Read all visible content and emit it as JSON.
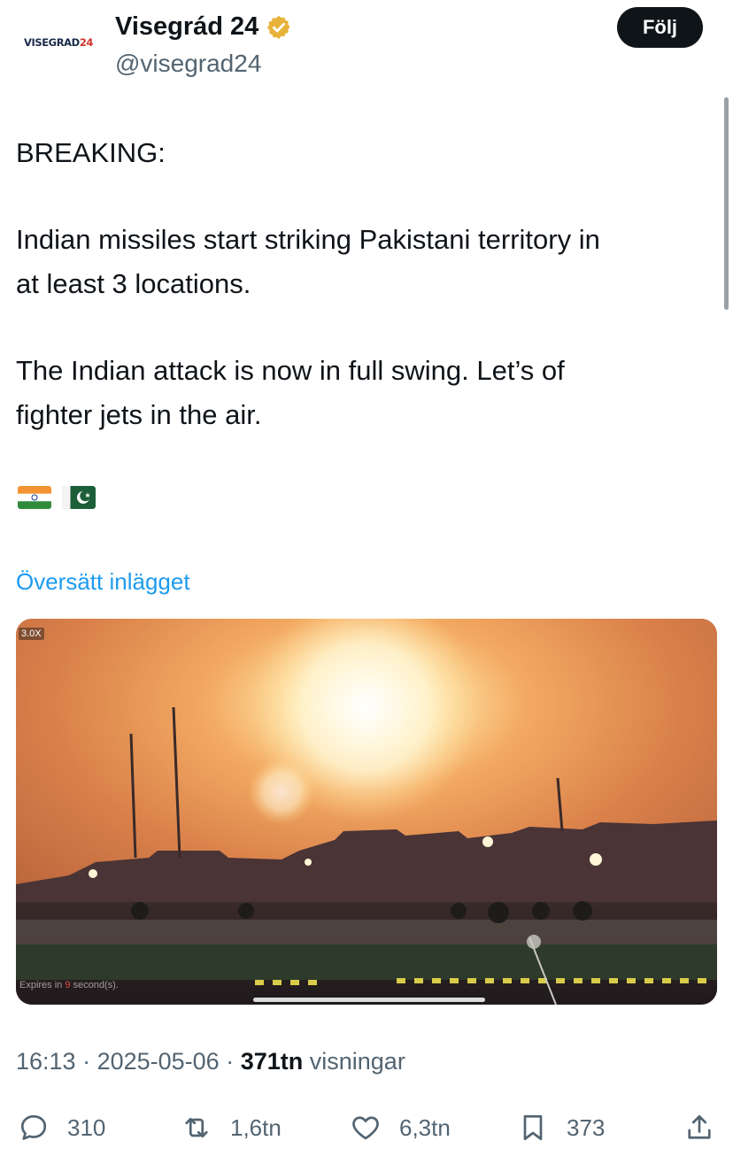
{
  "author": {
    "avatar_text_part1": "VISEGRAD",
    "avatar_text_part2": "24",
    "display_name": "Visegrád 24",
    "handle": "@visegrad24",
    "verified_badge": "gold-verified-icon"
  },
  "follow_button_label": "Följ",
  "tweet": {
    "line1": "BREAKING:",
    "line2": "Indian missiles start striking Pakistani territory in",
    "line3": "at least 3 locations.",
    "line4": "The Indian attack is now in full swing. Let’s of",
    "line5": "fighter jets in the air.",
    "flags": [
      "india-flag-icon",
      "pakistan-flag-icon"
    ]
  },
  "translate_link": "Översätt inlägget",
  "media": {
    "zoom_label": "3.0X",
    "expires_prefix": "Expires in ",
    "expires_number": "9",
    "expires_suffix": " second(s)."
  },
  "meta": {
    "time": "16:13",
    "separator": " · ",
    "date": "2025-05-06",
    "views_count": "371tn",
    "views_label": " visningar"
  },
  "actions": {
    "replies": "310",
    "reposts": "1,6tn",
    "likes": "6,3tn",
    "bookmarks": "373"
  },
  "colors": {
    "link": "#1d9bf0",
    "muted": "#536471",
    "text": "#0f1419",
    "verified_gold": "#e8b33a"
  }
}
